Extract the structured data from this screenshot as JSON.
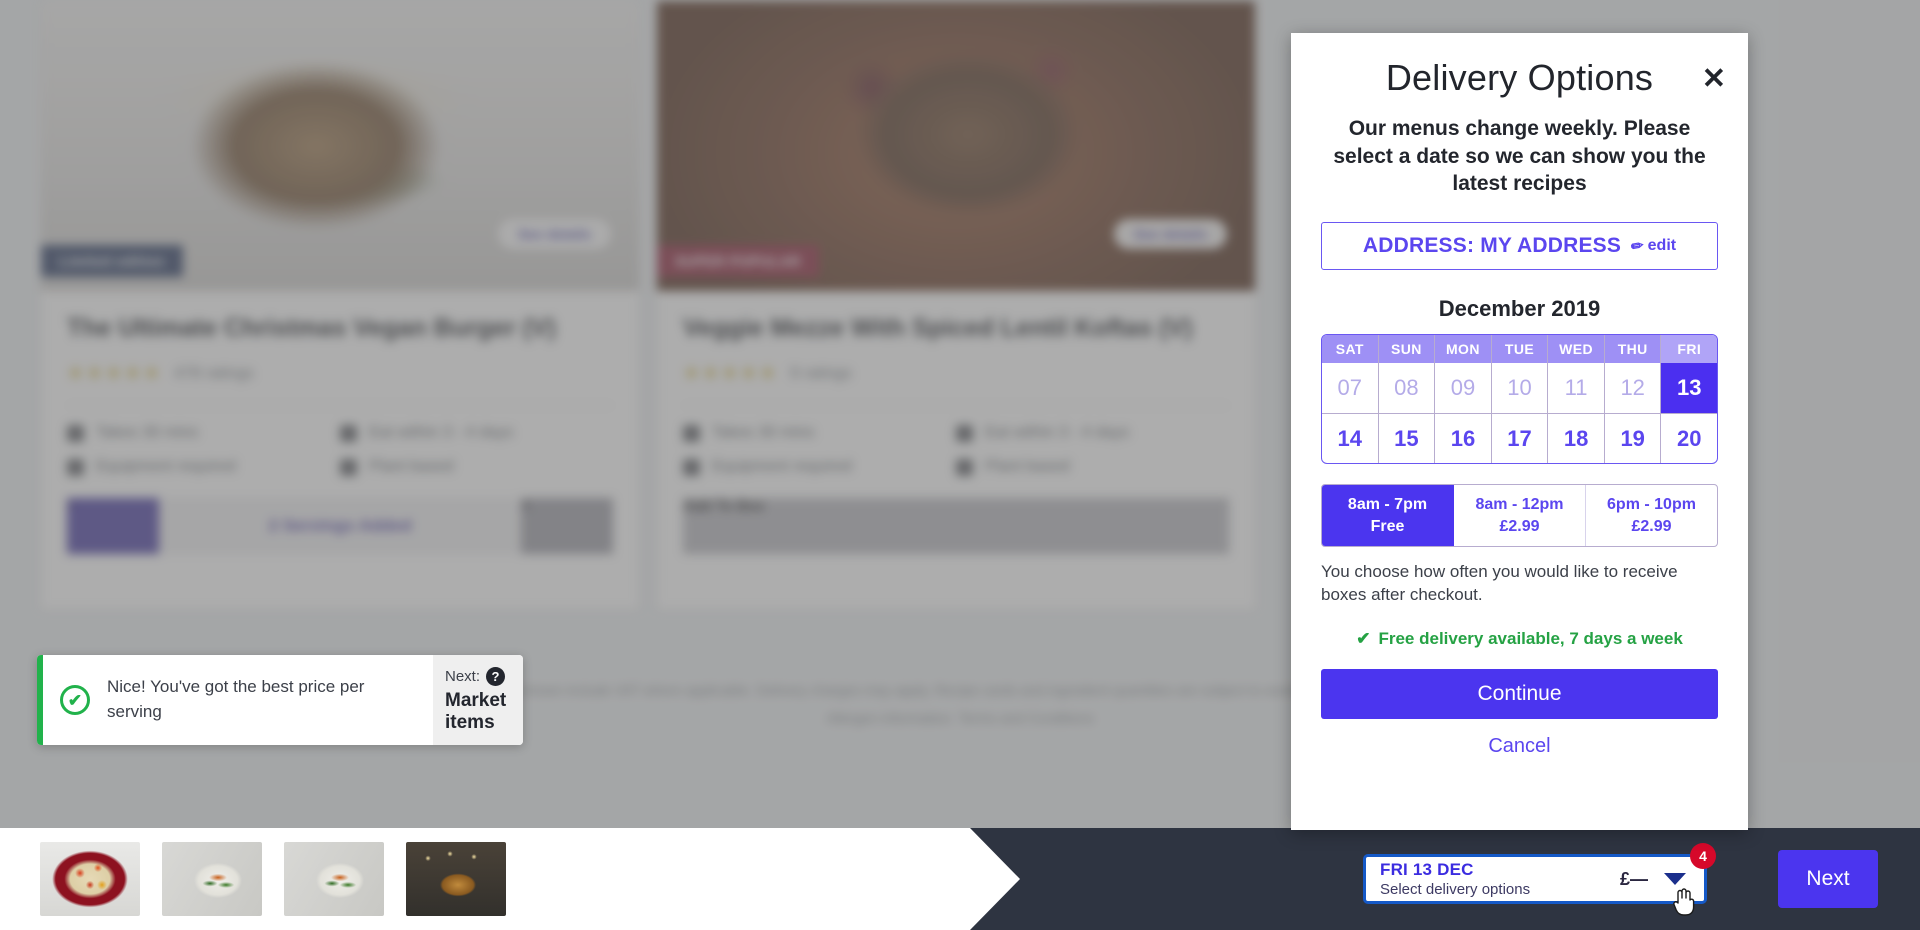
{
  "modal": {
    "title": "Delivery Options",
    "close_label": "✕",
    "subtitle": "Our menus change weekly. Please select a date so we can show you the latest recipes",
    "address_label": "ADDRESS: MY ADDRESS",
    "address_edit_label": "edit",
    "month_label": "December 2019",
    "weekdays": [
      "SAT",
      "SUN",
      "MON",
      "TUE",
      "WED",
      "THU",
      "FRI"
    ],
    "week1": [
      "07",
      "08",
      "09",
      "10",
      "11",
      "12",
      "13"
    ],
    "week2": [
      "14",
      "15",
      "16",
      "17",
      "18",
      "19",
      "20"
    ],
    "selected_date": "13",
    "time_slots": [
      {
        "time": "8am - 7pm",
        "price": "Free",
        "selected": true
      },
      {
        "time": "8am - 12pm",
        "price": "£2.99",
        "selected": false
      },
      {
        "time": "6pm - 10pm",
        "price": "£2.99",
        "selected": false
      }
    ],
    "note": "You choose how often you would like to receive boxes after checkout.",
    "free_delivery_text": "Free delivery available, 7 days a week",
    "free_delivery_check": "✔",
    "continue_label": "Continue",
    "cancel_label": "Cancel"
  },
  "toast": {
    "check_glyph": "✔",
    "message": "Nice! You've got the best price per serving",
    "next_prefix": "Next:",
    "help_glyph": "?",
    "next_label": "Market items"
  },
  "bottombar": {
    "delivery_date": "FRI 13 DEC",
    "delivery_sub": "Select delivery options",
    "delivery_price": "£—",
    "badge_count": "4",
    "next_label": "Next"
  },
  "cards": [
    {
      "badge": "Limited edition",
      "see_details": "See details",
      "title": "The Ultimate Christmas Vegan Burger (V)",
      "rating_stars": "★★★★★",
      "rating_count": "478 ratings",
      "meta": [
        "Takes 30 mins",
        "Eat within 3 - 4 days",
        "Equipment required",
        "Plant based"
      ],
      "qty_label": "2 Servings Added",
      "minus": "−",
      "plus": "+"
    },
    {
      "badge": "SUPER POPULAR",
      "see_details": "See details",
      "title": "Veggie Mezze With Spiced Lentil Koftas (V)",
      "rating_stars": "★★★★★",
      "rating_count": "9 ratings",
      "meta": [
        "Takes 30 mins",
        "Eat within 3 - 4 days",
        "Equipment required",
        "Plant based"
      ],
      "qty_label": "Add To Box",
      "minus": "−",
      "plus": "+"
    }
  ],
  "legal": {
    "line1": "Prices shown include VAT where applicable. Delivery charges may apply. Recipe cards and ingredient quantities are subject to availability and may change.",
    "line2": "Allergen information. Terms and Conditions"
  },
  "colors": {
    "accent": "#4b35ef",
    "accent_light": "#5b46ef",
    "calendar_header": "#9e90f5",
    "selected_date_bg": "#4b2ff0",
    "success_green": "#25a244",
    "badge_red": "#d6082a",
    "bottombar_bg": "#2e3441",
    "select_border": "#1559c7"
  }
}
